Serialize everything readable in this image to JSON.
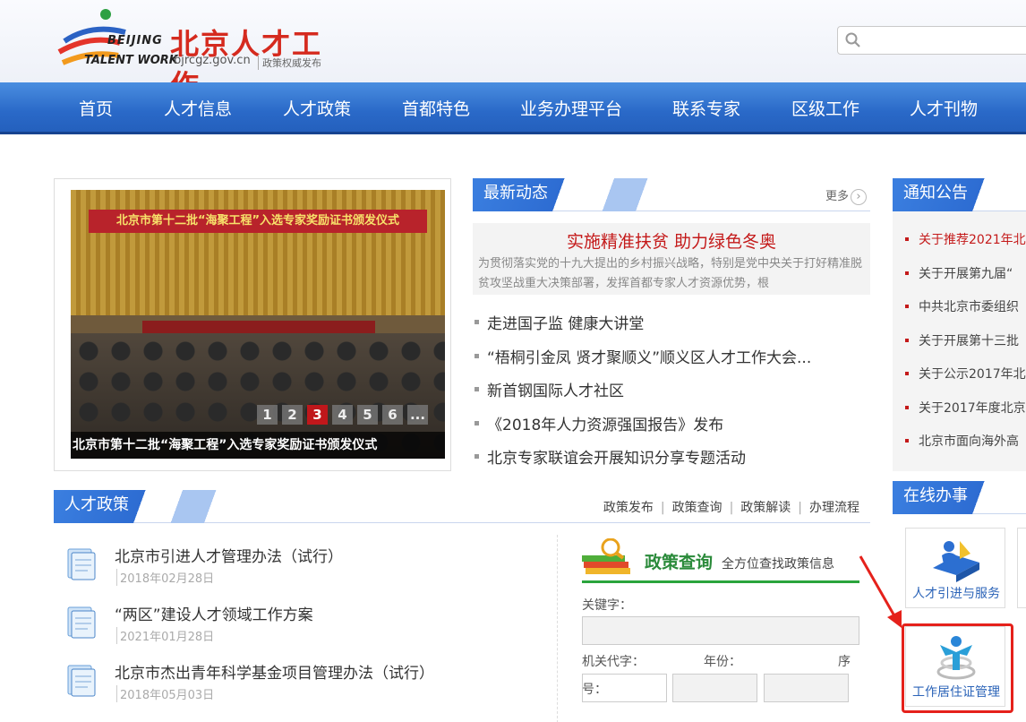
{
  "header": {
    "logo_en_line1": "BEIJING",
    "logo_en_line2": "TALENT WORK",
    "logo_cn": "北京人才工作",
    "logo_domain": "bjrcgz.gov.cn",
    "logo_slogan": "政策权威发布",
    "search_placeholder": ""
  },
  "nav": {
    "items": [
      "首页",
      "人才信息",
      "人才政策",
      "首都特色",
      "业务办理平台",
      "联系专家",
      "区级工作",
      "人才刊物"
    ]
  },
  "slider": {
    "banner_text": "北京市第十二批“海聚工程”入选专家奖励证书颁发仪式",
    "caption": "北京市第十二批“海聚工程”入选专家奖励证书颁发仪式",
    "pages": [
      "1",
      "2",
      "3",
      "4",
      "5",
      "6",
      "..."
    ],
    "active_page": "3"
  },
  "news": {
    "title": "最新动态",
    "more": "更多",
    "headline_title": "实施精准扶贫 助力绿色冬奥",
    "headline_summary": "为贯彻落实党的十九大提出的乡村振兴战略，特别是党中央关于打好精准脱贫攻坚战重大决策部署，发挥首都专家人才资源优势，根",
    "items": [
      "走进国子监 健康大讲堂",
      "“梧桐引金凤 贤才聚顺义”顺义区人才工作大会...",
      "新首钢国际人才社区",
      "《2018年人力资源强国报告》发布",
      "北京专家联谊会开展知识分享专题活动"
    ]
  },
  "notice": {
    "title": "通知公告",
    "items": [
      "关于推荐2021年北",
      "关于开展第九届“",
      "中共北京市委组织",
      "关于开展第十三批",
      "关于公示2017年北",
      "关于2017年度北京",
      "北京市面向海外高"
    ]
  },
  "policy": {
    "title": "人才政策",
    "links": [
      "政策发布",
      "政策查询",
      "政策解读",
      "办理流程"
    ],
    "items": [
      {
        "title": "北京市引进人才管理办法（试行）",
        "date": "2018年02月28日"
      },
      {
        "title": "“两区”建设人才领域工作方案",
        "date": "2021年01月28日"
      },
      {
        "title": "北京市杰出青年科学基金项目管理办法（试行）",
        "date": "2018年05月03日"
      }
    ]
  },
  "query": {
    "title": "政策查询",
    "subtitle": "全方位查找政策信息",
    "keyword_label": "关键字：",
    "org_label": "机关代字：",
    "year_label": "年份：",
    "seq_label_1": "序",
    "seq_label_2": "号："
  },
  "online": {
    "title": "在线办事",
    "services": [
      "人才引进与服务",
      "工作居住证管理"
    ]
  },
  "colors": {
    "nav_blue": "#2a69c8",
    "brand_red": "#d52a1e",
    "highlight_red": "#e5211b",
    "query_green": "#2a8a3a"
  }
}
